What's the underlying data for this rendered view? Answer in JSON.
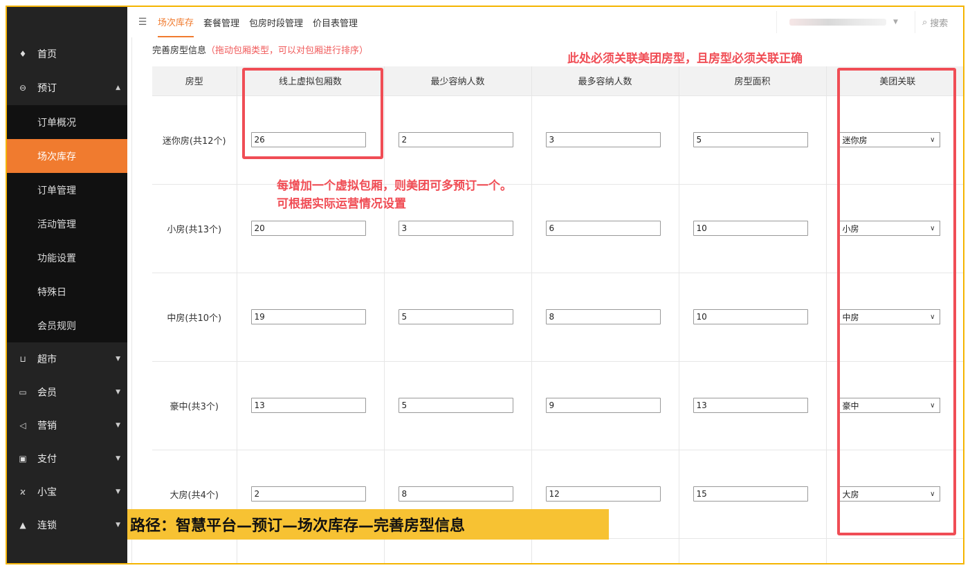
{
  "sidebar": {
    "items": [
      {
        "label": "首页",
        "icon": "home-icon",
        "glyph": "♦"
      },
      {
        "label": "预订",
        "icon": "reserve-icon",
        "glyph": "⊖",
        "caret": "▲"
      }
    ],
    "sub_items": [
      {
        "label": "订单概况",
        "active": false
      },
      {
        "label": "场次库存",
        "active": true
      },
      {
        "label": "订单管理",
        "active": false
      },
      {
        "label": "活动管理",
        "active": false
      },
      {
        "label": "功能设置",
        "active": false
      },
      {
        "label": "特殊日",
        "active": false
      },
      {
        "label": "会员规则",
        "active": false
      }
    ],
    "bottom_items": [
      {
        "label": "超市",
        "icon": "basket-icon",
        "glyph": "⊔"
      },
      {
        "label": "会员",
        "icon": "card-icon",
        "glyph": "▭"
      },
      {
        "label": "营销",
        "icon": "megaphone-icon",
        "glyph": "◁"
      },
      {
        "label": "支付",
        "icon": "wallet-icon",
        "glyph": "▣"
      },
      {
        "label": "小宝",
        "icon": "assistant-icon",
        "glyph": "ϰ"
      },
      {
        "label": "连锁",
        "icon": "store-icon",
        "glyph": "▲"
      }
    ]
  },
  "topbar": {
    "menu_glyph": "☰",
    "tabs": [
      "场次库存",
      "套餐管理",
      "包房时段管理",
      "价目表管理"
    ],
    "search_label": "搜索"
  },
  "section": {
    "title": "完善房型信息",
    "hint": "（拖动包厢类型，可以对包厢进行排序）"
  },
  "table": {
    "headers": [
      "房型",
      "线上虚拟包厢数",
      "最少容纳人数",
      "最多容纳人数",
      "房型面积",
      "美团关联"
    ],
    "rows": [
      {
        "name": "迷你房(共12个)",
        "virtual": "26",
        "min": "2",
        "max": "3",
        "area": "5",
        "meituan": "迷你房"
      },
      {
        "name": "小房(共13个)",
        "virtual": "20",
        "min": "3",
        "max": "6",
        "area": "10",
        "meituan": "小房"
      },
      {
        "name": "中房(共10个)",
        "virtual": "19",
        "min": "5",
        "max": "8",
        "area": "10",
        "meituan": "中房"
      },
      {
        "name": "豪中(共3个)",
        "virtual": "13",
        "min": "5",
        "max": "9",
        "area": "13",
        "meituan": "豪中"
      },
      {
        "name": "大房(共4个)",
        "virtual": "2",
        "min": "8",
        "max": "12",
        "area": "15",
        "meituan": "大房"
      }
    ]
  },
  "annotations": {
    "meituan_note": "此处必须关联美团房型，且房型必须关联正确",
    "virtual_note_line1": "每增加一个虚拟包厢，则美团可多预订一个。",
    "virtual_note_line2": "可根据实际运营情况设置",
    "path": "路径：智慧平台—预订—场次库存—完善房型信息"
  },
  "colors": {
    "accent": "#f07b2f",
    "annotation_red": "#f04d55",
    "banner_yellow": "#f7c233",
    "sidebar_bg": "#232323"
  }
}
